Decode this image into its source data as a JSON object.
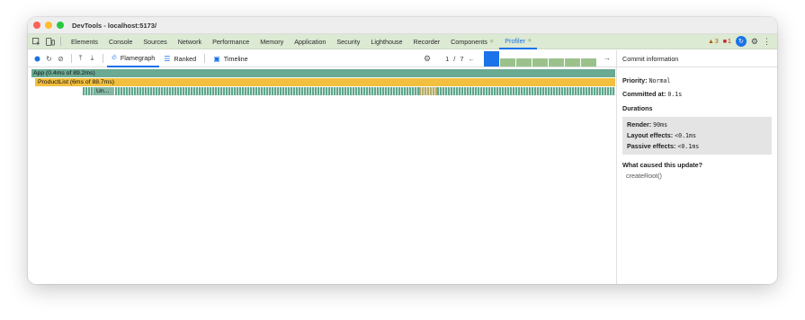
{
  "window": {
    "title": "DevTools - localhost:5173/"
  },
  "tabs": [
    {
      "label": "Elements"
    },
    {
      "label": "Console"
    },
    {
      "label": "Sources"
    },
    {
      "label": "Network"
    },
    {
      "label": "Performance"
    },
    {
      "label": "Memory"
    },
    {
      "label": "Application"
    },
    {
      "label": "Security"
    },
    {
      "label": "Lighthouse"
    },
    {
      "label": "Recorder"
    },
    {
      "label": "Components"
    },
    {
      "label": "Profiler"
    }
  ],
  "status": {
    "warnings": "3",
    "errors": "1"
  },
  "toolbar": {
    "flamegraph": "Flamegraph",
    "ranked": "Ranked",
    "timeline": "Timeline",
    "commit_index": "1",
    "commit_sep": "/",
    "commit_total": "7"
  },
  "commits": [
    {
      "value": 1.0
    },
    {
      "value": 0.55
    },
    {
      "value": 0.55
    },
    {
      "value": 0.55
    },
    {
      "value": 0.55
    },
    {
      "value": 0.55
    },
    {
      "value": 0.55
    }
  ],
  "flamegraph": {
    "app_label": "App (0.4ms of 89.2ms)",
    "list_label": "ProductList (6ms of 88.7ms)",
    "item_label": "Un..."
  },
  "panel": {
    "header": "Commit information",
    "priority_label": "Priority",
    "priority_value": "Normal",
    "committed_label": "Committed at",
    "committed_value": "0.1s",
    "durations_title": "Durations",
    "render_label": "Render",
    "render_value": "90ms",
    "layout_label": "Layout effects",
    "layout_value": "<0.1ms",
    "passive_label": "Passive effects",
    "passive_value": "<0.1ms",
    "cause_title": "What caused this update?",
    "cause_value": "createRoot()"
  },
  "colors": {
    "app": "#6aa992",
    "list": "#f2bf3e",
    "accent": "#1a73e8",
    "commit": "#9bc28b"
  }
}
